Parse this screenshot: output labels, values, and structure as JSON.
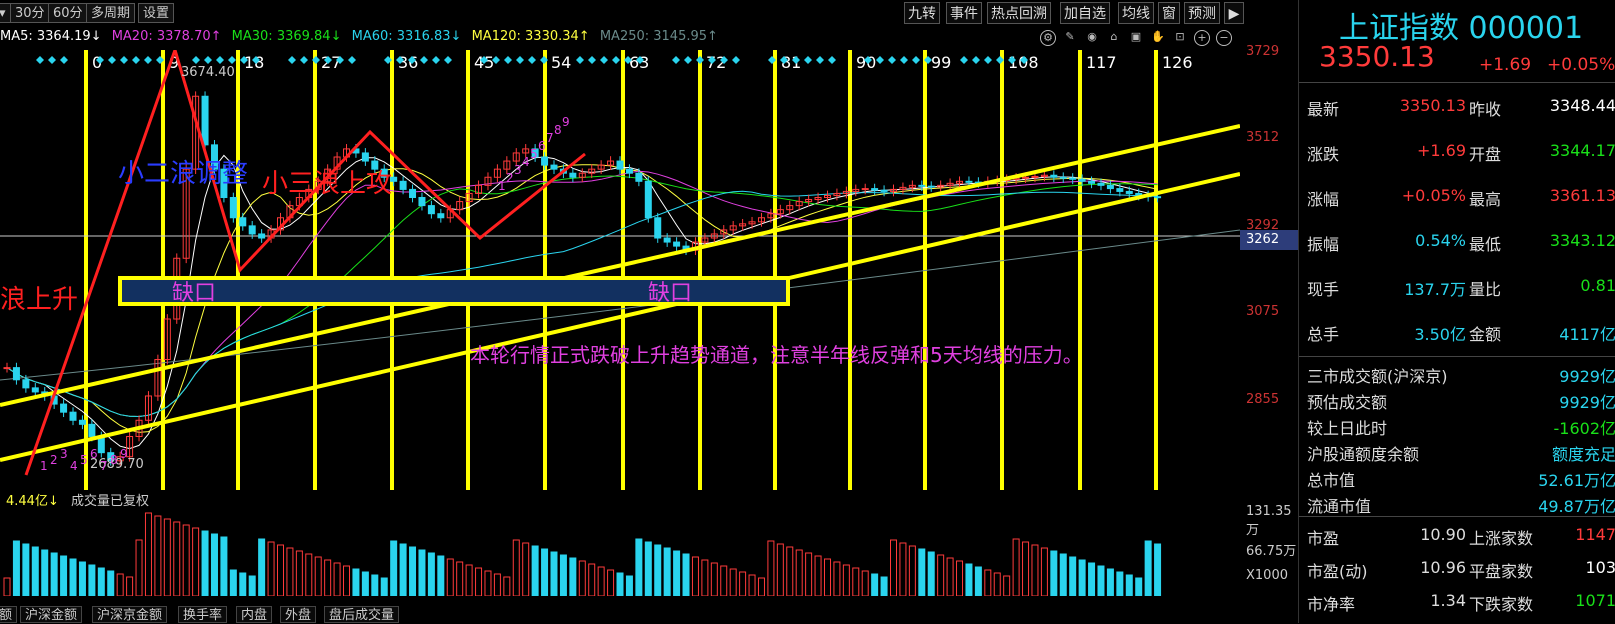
{
  "toolbar": {
    "left": [
      "30分",
      "60分",
      "多周期",
      "设置"
    ],
    "right": [
      "九转",
      "事件",
      "热点回溯",
      "加自选",
      "均线",
      "窗",
      "预测"
    ]
  },
  "ma_row": {
    "ma5": "MA5: 3364.19↓",
    "ma20": "MA20: 3378.70↑",
    "ma30": "MA30: 3369.84↓",
    "ma60": "MA60: 3316.83↓",
    "ma120": "MA120: 3330.34↑",
    "ma250": "MA250: 3145.95↑"
  },
  "colors": {
    "ma5": "#ffffff",
    "ma20": "#e040e0",
    "ma30": "#19e019",
    "ma60": "#2ad4ee",
    "ma120": "#ffff40",
    "ma250": "#6a8a8a",
    "up": "#ff3b3b",
    "down": "#2ad4ee",
    "annotation_line": "#ffff00",
    "red_line": "#ff2020"
  },
  "chart": {
    "cycle_labels": [
      "0",
      "9",
      "18",
      "27",
      "36",
      "45",
      "54",
      "63",
      "72",
      "81",
      "90",
      "99",
      "108",
      "117",
      "126"
    ],
    "y_axis": [
      "3729",
      "3512",
      "3292",
      "3075",
      "2855"
    ],
    "current_price_tag": "3262",
    "high_label": "3674.40",
    "low_label": "2689.70",
    "annotations": {
      "wave_left": "浪上升",
      "wave2": "小二浪调整",
      "wave3": "小三浪上攻",
      "gap1": "缺口",
      "gap2": "缺口",
      "comment": "本轮行情正式跌破上升趋势通道，注意半年线反弹和5天均线的压力。"
    },
    "nine_turn_marks": [
      "1",
      "2",
      "3",
      "4",
      "5",
      "6",
      "7",
      "8",
      "9"
    ]
  },
  "volume": {
    "header": "4.44亿↓",
    "header_label": "成交量已复权",
    "axis": [
      "131.35万",
      "66.75万",
      "X1000"
    ]
  },
  "bottom_tabs": [
    "额",
    "沪深金额",
    "沪深京金额",
    "换手率",
    "内盘",
    "外盘",
    "盘后成交量"
  ],
  "panel": {
    "title": "上证指数 000001",
    "price": "3350.13",
    "change": "+1.69",
    "change_pct": "+0.05%",
    "rows": [
      {
        "l1": "最新",
        "v1": "3350.13",
        "c1": "red",
        "l2": "昨收",
        "v2": "3348.44",
        "c2": "white"
      },
      {
        "l1": "涨跌",
        "v1": "+1.69",
        "c1": "red",
        "l2": "开盘",
        "v2": "3344.17",
        "c2": "grn"
      },
      {
        "l1": "涨幅",
        "v1": "+0.05%",
        "c1": "red",
        "l2": "最高",
        "v2": "3361.13",
        "c2": "red"
      },
      {
        "l1": "振幅",
        "v1": "0.54%",
        "c1": "cyan",
        "l2": "最低",
        "v2": "3343.12",
        "c2": "grn"
      },
      {
        "l1": "现手",
        "v1": "137.7万",
        "c1": "cyan",
        "l2": "量比",
        "v2": "0.81",
        "c2": "grn"
      },
      {
        "l1": "总手",
        "v1": "3.50亿",
        "c1": "cyan",
        "l2": "金额",
        "v2": "4117亿",
        "c2": "cyan"
      }
    ],
    "stats": [
      {
        "l": "三市成交额(沪深京)",
        "v": "9929亿"
      },
      {
        "l": "预估成交额",
        "v": "9929亿"
      },
      {
        "l": "较上日此时",
        "v": "-1602亿",
        "c": "grn"
      },
      {
        "l": "沪股通额度余额",
        "v": "额度充足"
      },
      {
        "l": "总市值",
        "v": "52.61万亿"
      },
      {
        "l": "流通市值",
        "v": "49.87万亿"
      }
    ],
    "bottom_rows": [
      {
        "l1": "市盈",
        "v1": "10.90",
        "l2": "上涨家数",
        "v2": "1147",
        "c2": "red"
      },
      {
        "l1": "市盈(动)",
        "v1": "10.96",
        "l2": "平盘家数",
        "v2": "103",
        "c2": "white"
      },
      {
        "l1": "市净率",
        "v1": "1.34",
        "l2": "下跌家数",
        "v2": "1071",
        "c2": "grn"
      }
    ]
  }
}
